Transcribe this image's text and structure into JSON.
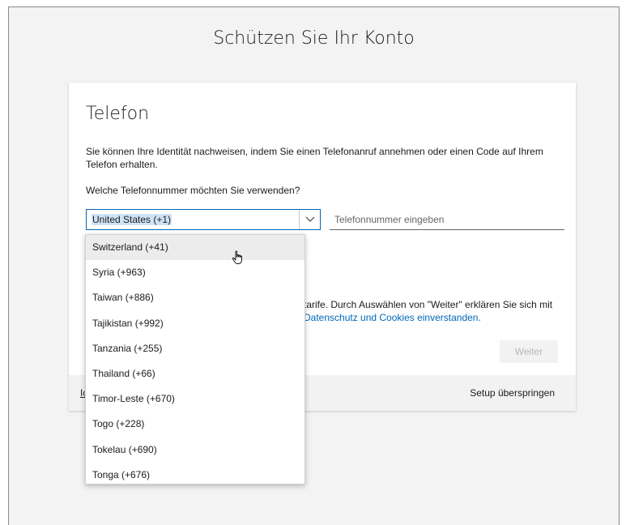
{
  "page": {
    "title": "Schützen Sie Ihr Konto"
  },
  "card": {
    "title": "Telefon",
    "description": "Sie können Ihre Identität nachweisen, indem Sie einen Telefonanruf annehmen oder einen Code auf Ihrem Telefon erhalten.",
    "question": "Welche Telefonnummer möchten Sie verwenden?",
    "country_select": {
      "value": "United States (+1)",
      "icon": "chevron-down-icon"
    },
    "phone_input": {
      "value": "",
      "placeholder": "Telefonnummer eingeben"
    },
    "legal_line1": "tarife. Durch Auswählen von \"Weiter\" erklären Sie sich mit",
    "legal_link": "Datenschutz und Cookies einverstanden.",
    "next_button": "Weiter"
  },
  "footer": {
    "left_link": "Ic",
    "skip_link": "Setup überspringen"
  },
  "dropdown": {
    "hovered_index": 0,
    "items": [
      "Switzerland (+41)",
      "Syria (+963)",
      "Taiwan (+886)",
      "Tajikistan (+992)",
      "Tanzania (+255)",
      "Thailand (+66)",
      "Timor-Leste (+670)",
      "Togo (+228)",
      "Tokelau (+690)",
      "Tonga (+676)"
    ]
  },
  "cursor": {
    "icon": "hand-pointer-icon"
  }
}
